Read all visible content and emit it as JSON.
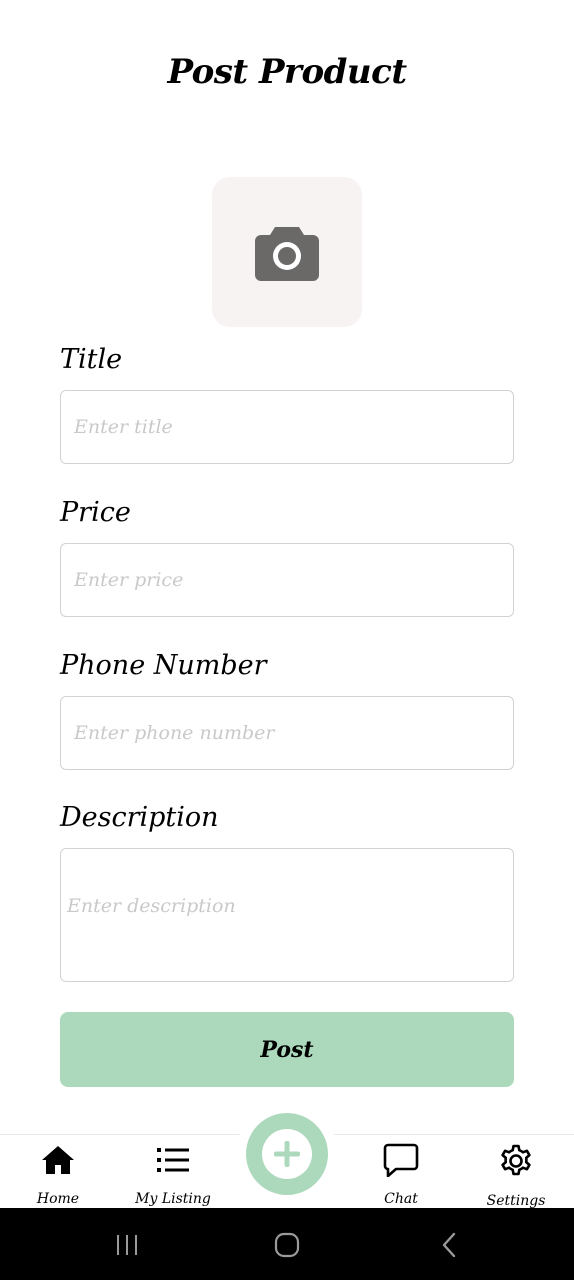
{
  "header": {
    "title": "Post Product"
  },
  "photo": {
    "icon": "camera-icon",
    "icon_color": "#6b6968"
  },
  "form": {
    "title": {
      "label": "Title",
      "placeholder": "Enter title",
      "value": ""
    },
    "price": {
      "label": "Price",
      "placeholder": "Enter price",
      "value": ""
    },
    "phone": {
      "label": "Phone Number",
      "placeholder": "Enter phone number",
      "value": ""
    },
    "description": {
      "label": "Description",
      "placeholder": "Enter description",
      "value": ""
    },
    "submit_label": "Post"
  },
  "bottom_nav": {
    "items": [
      {
        "label": "Home",
        "icon": "home-icon"
      },
      {
        "label": "My Listing",
        "icon": "list-icon"
      },
      {
        "label": "Chat",
        "icon": "chat-icon"
      },
      {
        "label": "Settings",
        "icon": "gear-icon"
      }
    ],
    "fab_icon": "add-icon"
  },
  "colors": {
    "accent": "#acd9bc",
    "photo_bg": "#f6f3f2",
    "placeholder": "#c9c9c9",
    "border": "#d2d2d2"
  },
  "system_nav": {
    "icons": [
      "recent-apps-icon",
      "home-circle-icon",
      "back-icon"
    ]
  }
}
